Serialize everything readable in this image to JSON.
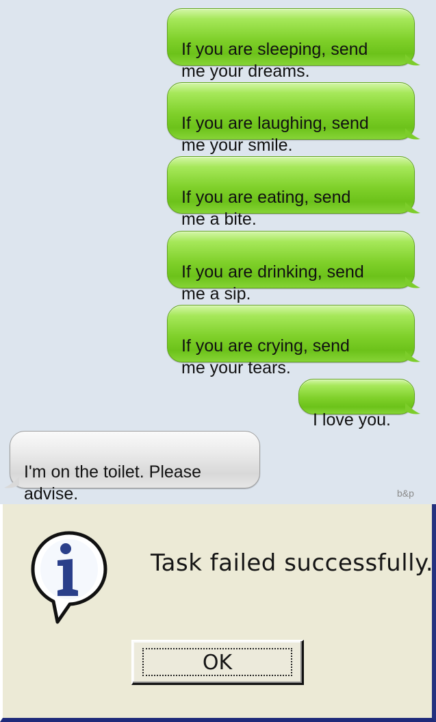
{
  "chat": {
    "messages": [
      {
        "direction": "outgoing",
        "text": "If you are sleeping, send\nme your dreams."
      },
      {
        "direction": "outgoing",
        "text": "If you are laughing, send\nme your smile."
      },
      {
        "direction": "outgoing",
        "text": "If you are eating, send\nme a bite."
      },
      {
        "direction": "outgoing",
        "text": "If you are drinking, send\nme a sip."
      },
      {
        "direction": "outgoing",
        "text": "If you are crying, send\nme your tears."
      },
      {
        "direction": "outgoing",
        "text": "I love you."
      },
      {
        "direction": "incoming",
        "text": "I'm on the toilet. Please\nadvise."
      }
    ],
    "watermark": "b&p",
    "colors": {
      "background": "#dde5ee",
      "outgoing_bubble": "#7fd02a",
      "incoming_bubble": "#e0e0e0"
    }
  },
  "dialog": {
    "icon": "info-icon",
    "message": "Task failed successfully.",
    "ok_label": "OK",
    "colors": {
      "background": "#ecead6",
      "frame": "#24317f"
    }
  }
}
